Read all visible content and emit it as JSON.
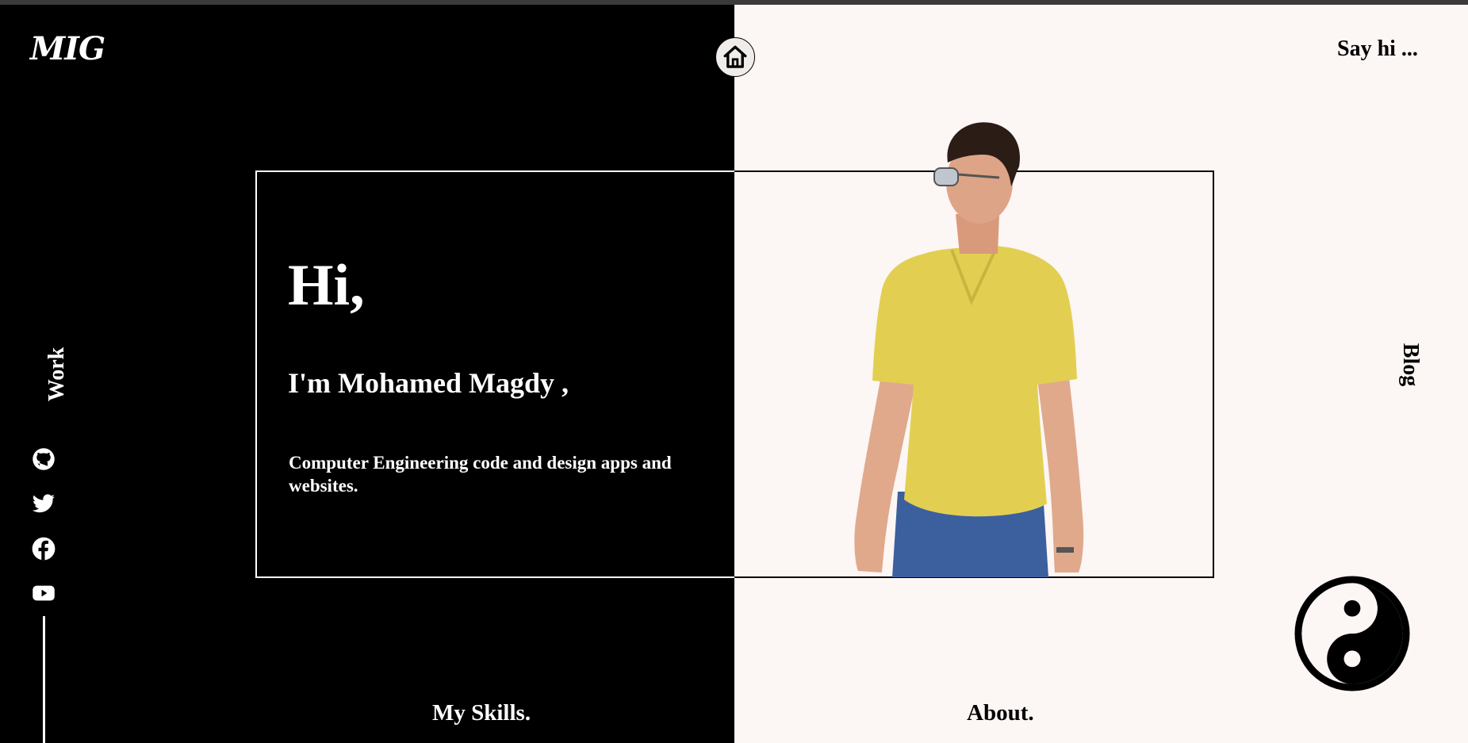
{
  "header": {
    "logo_text": "MIG",
    "home_icon": "home-icon",
    "say_hi_label": "Say hi ..."
  },
  "hero": {
    "greeting": "Hi,",
    "name": "I'm Mohamed Magdy ,",
    "description": "Computer Engineering code and design apps and websites."
  },
  "nav": {
    "work_label": "Work",
    "blog_label": "Blog",
    "skills_label": "My Skills.",
    "about_label": "About."
  },
  "social": [
    {
      "name": "github",
      "icon": "github-icon"
    },
    {
      "name": "twitter",
      "icon": "twitter-icon"
    },
    {
      "name": "facebook",
      "icon": "facebook-icon"
    },
    {
      "name": "youtube",
      "icon": "youtube-icon"
    }
  ],
  "theme_toggle_icon": "yin-yang-icon",
  "colors": {
    "dark": "#000000",
    "light": "#fcf6f4",
    "shirt": "#e2cf52",
    "jeans": "#3c5f9e"
  }
}
